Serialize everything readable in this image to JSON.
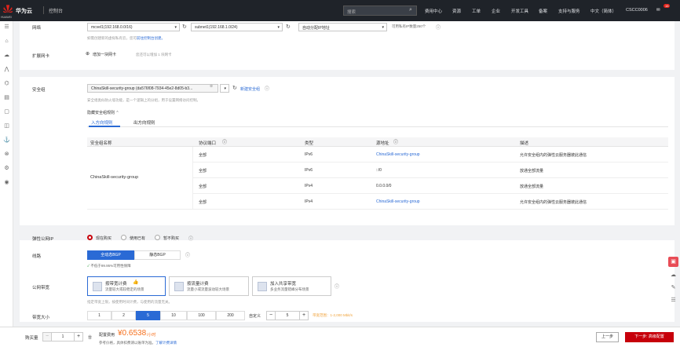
{
  "header": {
    "brand": "华为云",
    "logo_sub": "HUAWEI",
    "console": "控制台",
    "search_placeholder": "搜索",
    "nav": [
      "费用中心",
      "资源",
      "工单",
      "企业",
      "开发工具",
      "备案",
      "支持与服务",
      "中文（简体）",
      "CSCC0006"
    ],
    "badge": "15"
  },
  "network": {
    "label": "网络",
    "vpc": "mcvel1(192.168.0.0/16)",
    "subnet": "subnet1(192.168.1.0/24)",
    "ip_mode": "自动分配IP地址",
    "available_ips": "可用私有IP数量250个",
    "hint_prefix": "如需创建新的虚拟私有云，您可",
    "hint_link": "前往控制台创建。"
  },
  "nic": {
    "label": "扩展网卡",
    "add": "增加一块网卡",
    "add_hint": "您还可以增加 1 块网卡"
  },
  "security": {
    "label": "安全组",
    "group": "ChinaSkill-security-group (da576f08-7934-45e2-8d05-b3...",
    "new_link": "新建安全组",
    "hint": "安全组类似防火墙功能，是一个逻辑上的分组，用于设置网络访问控制。",
    "toggle": "隐藏安全组规则",
    "tabs": [
      "入方向规则",
      "出方向规则"
    ],
    "columns": [
      "安全组名称",
      "协议端口",
      "类型",
      "源地址",
      "描述"
    ],
    "group_name": "ChinaSkill-security-group",
    "rows": [
      {
        "port": "全部",
        "type": "IPv6",
        "source": "ChinaSkill-security-group",
        "desc": "允许安全组内的弹性云服务器彼此通信"
      },
      {
        "port": "全部",
        "type": "IPv6",
        "source": "::/0",
        "desc": "放通全部流量"
      },
      {
        "port": "全部",
        "type": "IPv4",
        "source": "0.0.0.0/0",
        "desc": "放通全部流量"
      },
      {
        "port": "全部",
        "type": "IPv4",
        "source": "ChinaSkill-security-group",
        "desc": "允许安全组内的弹性云服务器彼此通信"
      }
    ]
  },
  "eip": {
    "label": "弹性公网IP",
    "options": [
      "现在购买",
      "使用已有",
      "暂不购买"
    ]
  },
  "line": {
    "label": "线路",
    "options": [
      "全动态BGP",
      "静态BGP"
    ],
    "sla": "不低于99.95%可用性保障"
  },
  "billing": {
    "label": "公网带宽",
    "cards": [
      {
        "title": "按带宽计费",
        "desc": "流量较大或较稳定的场景"
      },
      {
        "title": "按流量计费",
        "desc": "流量小或流量波动较大场景"
      },
      {
        "title": "加入共享带宽",
        "desc": "多业务流量错峰分布场景"
      }
    ],
    "hint": "指定带宽上限，按使用时间计费，与使用的流量无关。"
  },
  "bandwidth": {
    "label": "带宽大小",
    "options": [
      "1",
      "2",
      "5",
      "10",
      "100",
      "200"
    ],
    "custom_label": "自定义",
    "value": "5",
    "range": "带宽范围：1-2,000 Mbit/s"
  },
  "footer": {
    "qty_label": "购买量",
    "qty": "1",
    "unit": "台",
    "price_label": "配置费用",
    "price": "¥0.6538",
    "price_unit": "/小时",
    "note": "参考价格，具体扣费请以账单为准。",
    "note_link": "了解计费详情",
    "prev": "上一步",
    "next": "下一步: 高级配置"
  },
  "colors": {
    "accent": "#2a6ad5",
    "brand": "#c7000b",
    "topbar": "#1f2329"
  }
}
